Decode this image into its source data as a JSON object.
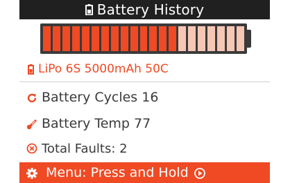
{
  "header": {
    "title": "Battery History"
  },
  "battery": {
    "filled_segments": 14,
    "total_segments": 21,
    "fill_fraction": 0.667,
    "color_filled": "#ef4a24",
    "color_empty": "#f6c7b4",
    "outline_color": "#3a3a3a"
  },
  "model": {
    "label": "LiPo 6S 5000mAh 50C",
    "color": "#ef4a24"
  },
  "stats": {
    "cycles_label": "Battery Cycles 16",
    "temp_label": "Battery Temp 77",
    "faults_label": "Total Faults: 2"
  },
  "menu": {
    "label": "Menu: Press and Hold",
    "color": "#ef4a24"
  },
  "icons": {
    "header": "battery-icon",
    "model": "battery-icon",
    "cycles": "refresh-icon",
    "temp": "thermometer-icon",
    "faults": "x-circle-icon",
    "menu_left": "gear-icon",
    "menu_right": "play-circle-icon"
  }
}
